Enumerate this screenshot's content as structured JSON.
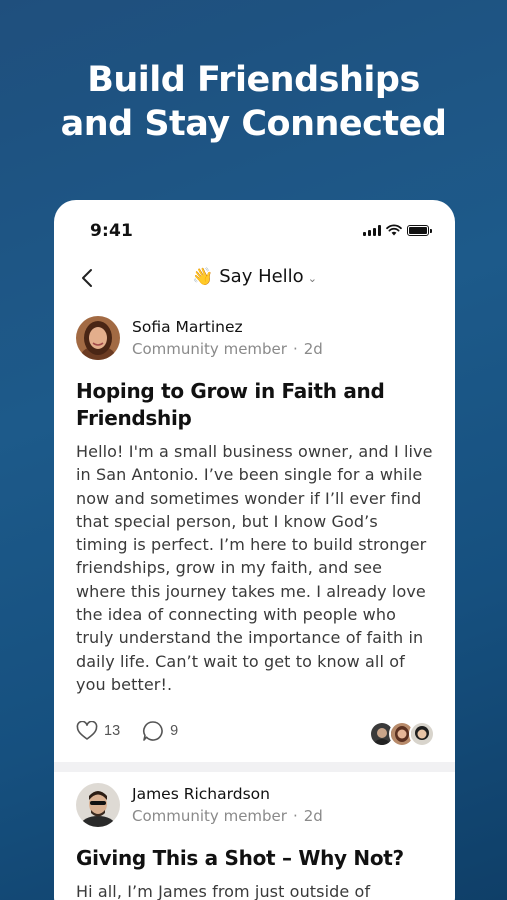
{
  "headline": {
    "line1": "Build Friendships",
    "line2": "and Stay Connected"
  },
  "status_bar": {
    "time": "9:41"
  },
  "nav": {
    "emoji": "👋",
    "title": "Say Hello"
  },
  "posts": [
    {
      "author": "Sofia Martinez",
      "role": "Community member",
      "age": "2d",
      "title": "Hoping to Grow in Faith and Friendship",
      "body": "Hello! I'm a small business owner, and I live in San Antonio. I’ve been single for a while now and sometimes wonder if I’ll ever find that special person, but I know God’s timing is perfect. I’m here to build stronger friendships, grow in my faith, and see where this journey takes me. I already love the idea of connecting with people who truly understand the importance of faith in daily life. Can’t wait to get to know all of you better!.",
      "likes": "13",
      "comments": "9"
    },
    {
      "author": "James Richardson",
      "role": "Community member",
      "age": "2d",
      "title": "Giving This a Shot – Why Not?",
      "body": "Hi all, I’m James from just outside of Boston. I"
    }
  ],
  "colors": {
    "background_top": "#1f4f7d",
    "background_bottom": "#0f3f68",
    "card": "#ffffff",
    "muted_text": "#8a8a8a"
  }
}
